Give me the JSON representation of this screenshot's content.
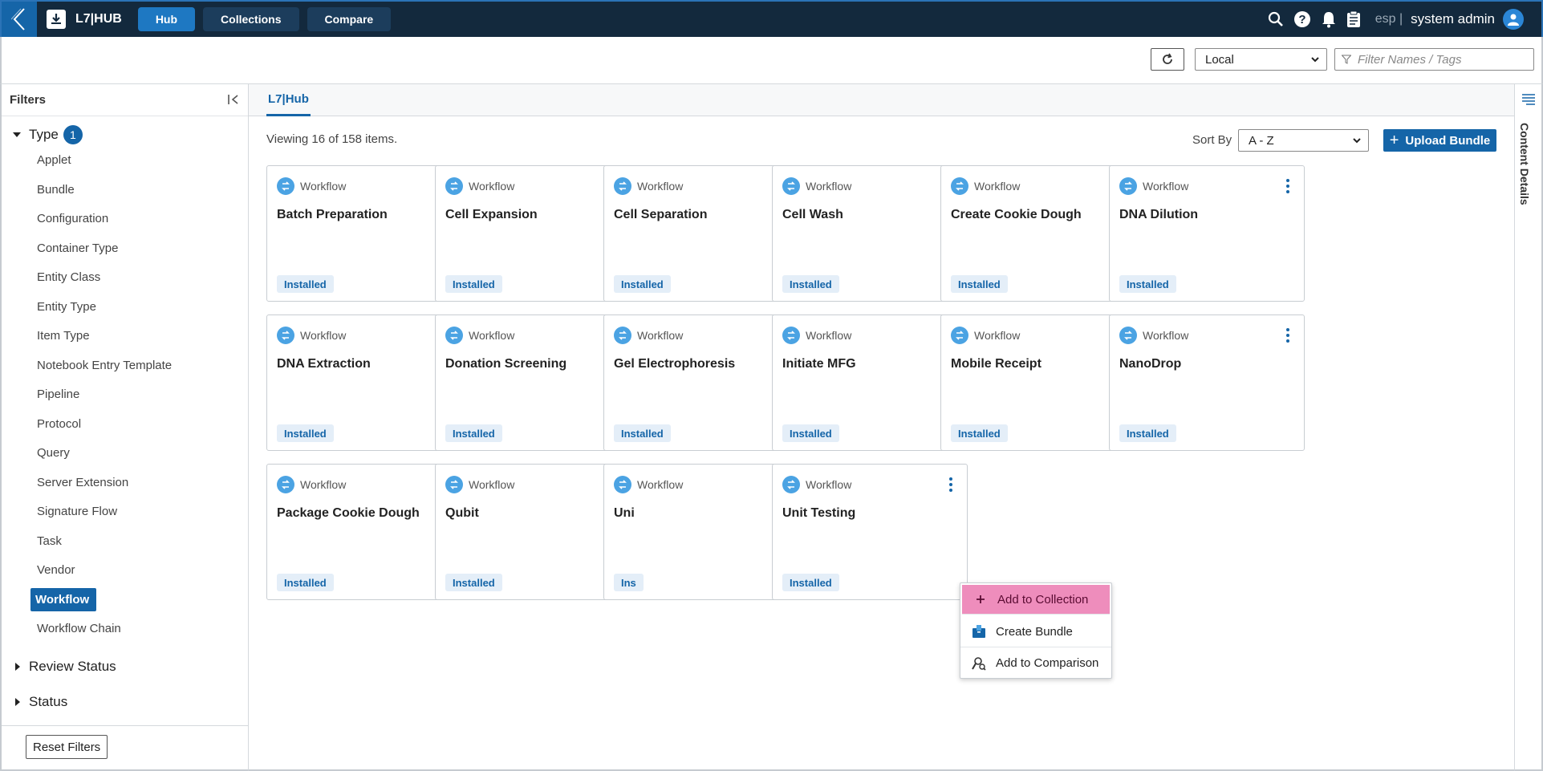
{
  "header": {
    "app_name": "L7|HUB",
    "nav": [
      {
        "label": "Hub",
        "active": true
      },
      {
        "label": "Collections",
        "active": false
      },
      {
        "label": "Compare",
        "active": false
      }
    ],
    "lang": "esp |",
    "user": "system admin"
  },
  "toolbar": {
    "env_value": "Local",
    "filter_placeholder": "Filter Names / Tags"
  },
  "sidebar": {
    "title": "Filters",
    "type_label": "Type",
    "type_count": "1",
    "types": [
      "Applet",
      "Bundle",
      "Configuration",
      "Container Type",
      "Entity Class",
      "Entity Type",
      "Item Type",
      "Notebook Entry Template",
      "Pipeline",
      "Protocol",
      "Query",
      "Server Extension",
      "Signature Flow",
      "Task",
      "Vendor",
      "Workflow",
      "Workflow Chain"
    ],
    "selected_type": "Workflow",
    "sections": [
      "Review Status",
      "Status"
    ],
    "reset_label": "Reset Filters"
  },
  "main": {
    "tab": "L7|Hub",
    "viewing": "Viewing 16 of 158 items.",
    "sort_label": "Sort By",
    "sort_value": "A - Z",
    "upload_label": "Upload Bundle",
    "cards": [
      {
        "type": "Workflow",
        "title": "Batch Preparation",
        "status": "Installed"
      },
      {
        "type": "Workflow",
        "title": "Cell Expansion",
        "status": "Installed"
      },
      {
        "type": "Workflow",
        "title": "Cell Separation",
        "status": "Installed"
      },
      {
        "type": "Workflow",
        "title": "Cell Wash",
        "status": "Installed"
      },
      {
        "type": "Workflow",
        "title": "Create Cookie Dough",
        "status": "Installed"
      },
      {
        "type": "Workflow",
        "title": "DNA Dilution",
        "status": "Installed"
      },
      {
        "type": "Workflow",
        "title": "DNA Extraction",
        "status": "Installed"
      },
      {
        "type": "Workflow",
        "title": "Donation Screening",
        "status": "Installed"
      },
      {
        "type": "Workflow",
        "title": "Gel Electrophoresis",
        "status": "Installed"
      },
      {
        "type": "Workflow",
        "title": "Initiate MFG",
        "status": "Installed"
      },
      {
        "type": "Workflow",
        "title": "Mobile Receipt",
        "status": "Installed"
      },
      {
        "type": "Workflow",
        "title": "NanoDrop",
        "status": "Installed"
      },
      {
        "type": "Workflow",
        "title": "Package Cookie Dough",
        "status": "Installed"
      },
      {
        "type": "Workflow",
        "title": "Qubit",
        "status": "Installed"
      },
      {
        "type": "Workflow",
        "title": "Uni",
        "status": "Ins"
      },
      {
        "type": "Workflow",
        "title": "Unit Testing",
        "status": "Installed"
      }
    ],
    "menu": [
      "Add to Collection",
      "Create Bundle",
      "Add to Comparison"
    ]
  },
  "right_rail": {
    "label": "Content Details"
  },
  "colors": {
    "topbar": "#13293d",
    "primary": "#1565a8",
    "focus": "#d81b7b",
    "menu_highlight": "#ee8dbc"
  },
  "icons": [
    "back-chevron-icon",
    "download-icon",
    "search-icon",
    "help-icon",
    "bell-icon",
    "clipboard-icon",
    "user-icon",
    "refresh-icon",
    "filter-icon",
    "collapse-icon",
    "workflow-icon",
    "kebab-icon",
    "plus-icon",
    "bundle-icon",
    "compare-icon",
    "list-icon"
  ]
}
